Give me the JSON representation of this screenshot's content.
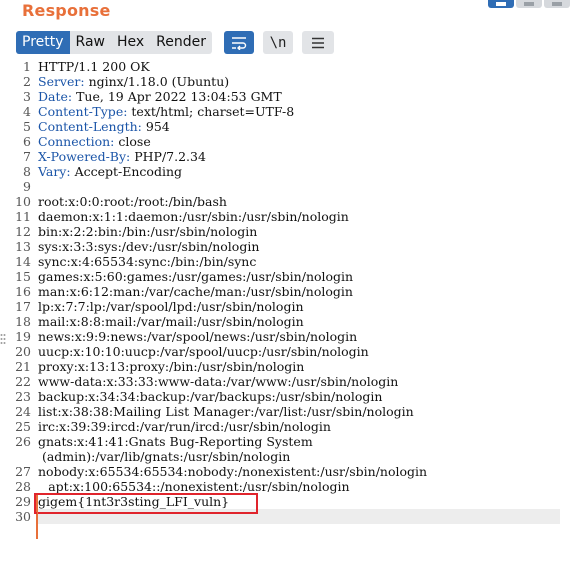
{
  "panel": {
    "title": "Response"
  },
  "toolbar": {
    "tabs": [
      "Pretty",
      "Raw",
      "Hex",
      "Render"
    ],
    "active_tab": "Pretty",
    "wrap_label": "\\n"
  },
  "editor": {
    "lines": [
      {
        "n": "1",
        "key": "",
        "rest": "HTTP/1.1 200 OK"
      },
      {
        "n": "2",
        "key": "Server:",
        "rest": " nginx/1.18.0 (Ubuntu)"
      },
      {
        "n": "3",
        "key": "Date:",
        "rest": " Tue, 19 Apr 2022 13:04:53 GMT"
      },
      {
        "n": "4",
        "key": "Content-Type:",
        "rest": " text/html; charset=UTF-8"
      },
      {
        "n": "5",
        "key": "Content-Length:",
        "rest": " 954"
      },
      {
        "n": "6",
        "key": "Connection:",
        "rest": " close"
      },
      {
        "n": "7",
        "key": "X-Powered-By:",
        "rest": " PHP/7.2.34"
      },
      {
        "n": "8",
        "key": "Vary:",
        "rest": " Accept-Encoding"
      },
      {
        "n": "9",
        "key": "",
        "rest": ""
      },
      {
        "n": "10",
        "key": "",
        "rest": "root:x:0:0:root:/root:/bin/bash"
      },
      {
        "n": "11",
        "key": "",
        "rest": "daemon:x:1:1:daemon:/usr/sbin:/usr/sbin/nologin"
      },
      {
        "n": "12",
        "key": "",
        "rest": "bin:x:2:2:bin:/bin:/usr/sbin/nologin"
      },
      {
        "n": "13",
        "key": "",
        "rest": "sys:x:3:3:sys:/dev:/usr/sbin/nologin"
      },
      {
        "n": "14",
        "key": "",
        "rest": "sync:x:4:65534:sync:/bin:/bin/sync"
      },
      {
        "n": "15",
        "key": "",
        "rest": "games:x:5:60:games:/usr/games:/usr/sbin/nologin"
      },
      {
        "n": "16",
        "key": "",
        "rest": "man:x:6:12:man:/var/cache/man:/usr/sbin/nologin"
      },
      {
        "n": "17",
        "key": "",
        "rest": "lp:x:7:7:lp:/var/spool/lpd:/usr/sbin/nologin"
      },
      {
        "n": "18",
        "key": "",
        "rest": "mail:x:8:8:mail:/var/mail:/usr/sbin/nologin"
      },
      {
        "n": "19",
        "key": "",
        "rest": "news:x:9:9:news:/var/spool/news:/usr/sbin/nologin"
      },
      {
        "n": "20",
        "key": "",
        "rest": "uucp:x:10:10:uucp:/var/spool/uucp:/usr/sbin/nologin"
      },
      {
        "n": "21",
        "key": "",
        "rest": "proxy:x:13:13:proxy:/bin:/usr/sbin/nologin"
      },
      {
        "n": "22",
        "key": "",
        "rest": "www-data:x:33:33:www-data:/var/www:/usr/sbin/nologin"
      },
      {
        "n": "23",
        "key": "",
        "rest": "backup:x:34:34:backup:/var/backups:/usr/sbin/nologin"
      },
      {
        "n": "24",
        "key": "",
        "rest": "list:x:38:38:Mailing List Manager:/var/list:/usr/sbin/nologin"
      },
      {
        "n": "25",
        "key": "",
        "rest": "irc:x:39:39:ircd:/var/run/ircd:/usr/sbin/nologin"
      },
      {
        "n": "26",
        "key": "",
        "rest": "gnats:x:41:41:Gnats Bug-Reporting System"
      },
      {
        "n": "",
        "key": "",
        "rest": " (admin):/var/lib/gnats:/usr/sbin/nologin"
      },
      {
        "n": "27",
        "key": "",
        "rest": "nobody:x:65534:65534:nobody:/nonexistent:/usr/sbin/nologin"
      },
      {
        "n": "28",
        "key": "",
        "rest": " _apt:x:100:65534::/nonexistent:/usr/sbin/nologin"
      },
      {
        "n": "29",
        "key": "",
        "rest": "gigem{1nt3r3sting_LFI_vuln}"
      },
      {
        "n": "30",
        "key": "",
        "rest": ""
      }
    ]
  },
  "colors": {
    "accent": "#e8703a",
    "active": "#2f6db5",
    "header_key": "#1b55a8",
    "highlight": "#e0242c"
  }
}
